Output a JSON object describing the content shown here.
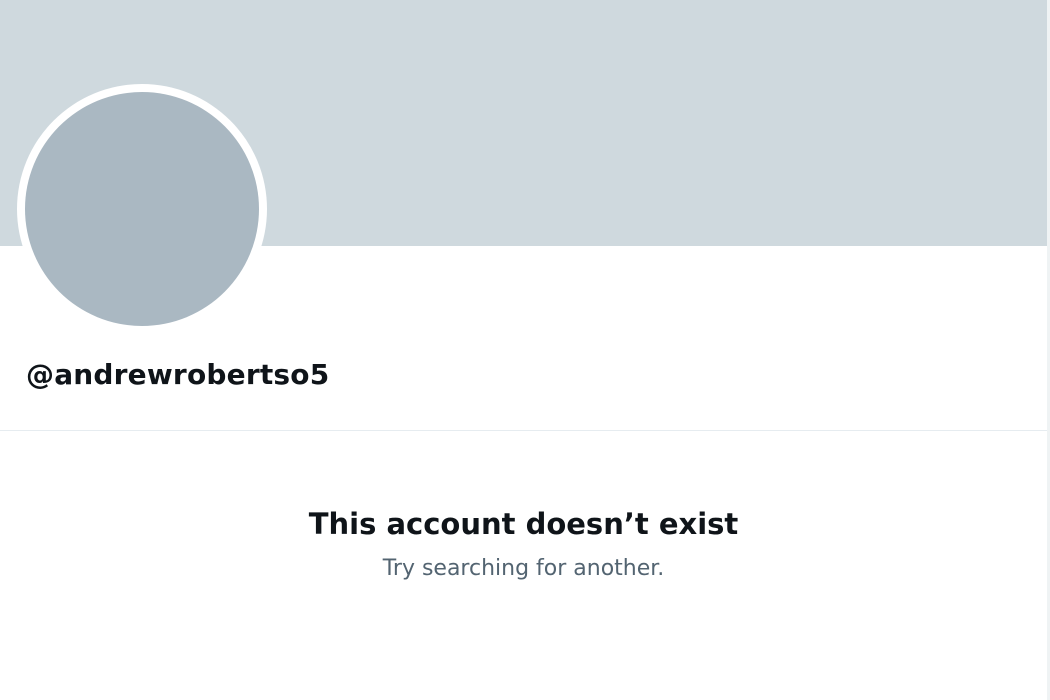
{
  "profile": {
    "handle": "@andrewrobertso5"
  },
  "empty_state": {
    "title": "This account doesn’t exist",
    "subtitle": "Try searching for another."
  },
  "colors": {
    "banner": "#cfd9de",
    "avatar": "#aab8c2",
    "primary_text": "#0f1419",
    "secondary_text": "#536471",
    "divider": "#e6ecf0"
  }
}
